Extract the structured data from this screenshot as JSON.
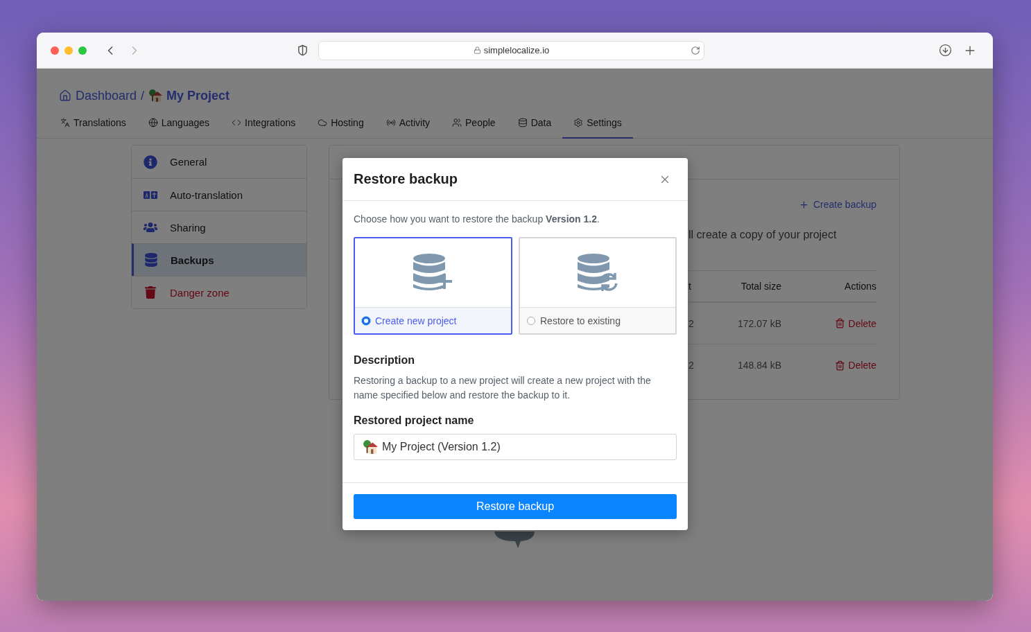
{
  "browser": {
    "url": "simplelocalize.io"
  },
  "breadcrumb": {
    "home": "Dashboard",
    "separator": "/",
    "project": "My Project"
  },
  "tabs": [
    {
      "label": "Translations",
      "kind": "translations",
      "selected": false
    },
    {
      "label": "Languages",
      "kind": "languages",
      "selected": false
    },
    {
      "label": "Integrations",
      "kind": "integrations",
      "selected": false
    },
    {
      "label": "Hosting",
      "kind": "hosting",
      "selected": false
    },
    {
      "label": "Activity",
      "kind": "activity",
      "selected": false
    },
    {
      "label": "People",
      "kind": "people",
      "selected": false
    },
    {
      "label": "Data",
      "kind": "data",
      "selected": false
    },
    {
      "label": "Settings",
      "kind": "settings",
      "selected": true
    }
  ],
  "sidebar": [
    {
      "label": "General",
      "kind": "general",
      "selected": false
    },
    {
      "label": "Auto-translation",
      "kind": "translation",
      "selected": false
    },
    {
      "label": "Sharing",
      "kind": "sharing",
      "selected": false
    },
    {
      "label": "Backups",
      "kind": "backups",
      "selected": true
    },
    {
      "label": "Danger zone",
      "kind": "danger",
      "selected": false
    }
  ],
  "backups_card": {
    "create_button": "Create backup",
    "description": "ll create a copy of your project",
    "table": {
      "columns": [
        "t",
        "Total size",
        "Actions"
      ],
      "rows": [
        {
          "cells": [
            "2",
            "172.07 kB"
          ],
          "action": "Delete"
        },
        {
          "cells": [
            "2",
            "148.84 kB"
          ],
          "action": "Delete"
        }
      ]
    }
  },
  "dialog": {
    "title": "Restore backup",
    "intro": "Choose how you want to restore the backup **Version 1.2**.",
    "options": [
      {
        "label": "Create new project",
        "kind": "new",
        "selected": true
      },
      {
        "label": "Restore to existing",
        "kind": "existing",
        "selected": false
      }
    ],
    "description_heading": "Description",
    "description": "Restoring a backup to a new project will create a new project with the name specified below and restore the backup to it.",
    "name_label": "Restored project name",
    "name_value": "My Project (Version 1.2)",
    "submit": "Restore backup"
  }
}
